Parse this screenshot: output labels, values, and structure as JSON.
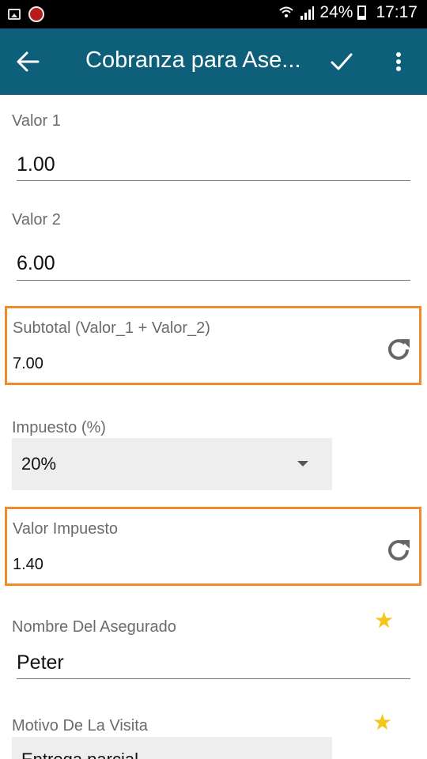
{
  "status_bar": {
    "icons": [
      "image-icon",
      "record-icon",
      "wifi-icon",
      "signal-icon",
      "battery-icon"
    ],
    "battery": "24%",
    "time": "17:17"
  },
  "app_bar": {
    "title": "Cobranza para Ase...",
    "back_icon": "arrow-left-icon",
    "confirm_icon": "check-icon",
    "menu_icon": "more-vert-icon",
    "color": "#0d5f7a"
  },
  "form": {
    "valor1": {
      "label": "Valor 1",
      "value": "1.00"
    },
    "valor2": {
      "label": "Valor 2",
      "value": "6.00"
    },
    "subtotal": {
      "label": "Subtotal (Valor_1 + Valor_2)",
      "value": "7.00",
      "icon": "refresh-icon"
    },
    "impuesto": {
      "label": "Impuesto (%)",
      "value": "20%"
    },
    "valor_impuesto": {
      "label": "Valor Impuesto",
      "value": "1.40",
      "icon": "refresh-icon"
    },
    "nombre": {
      "label": "Nombre Del Asegurado",
      "value": "Peter",
      "required_icon": "star-icon"
    },
    "motivo": {
      "label": "Motivo De La Visita",
      "value": "Entrega parcial",
      "required_icon": "star-icon"
    }
  },
  "colors": {
    "highlight_border": "#f28a2c",
    "required_star": "#f5c518"
  }
}
